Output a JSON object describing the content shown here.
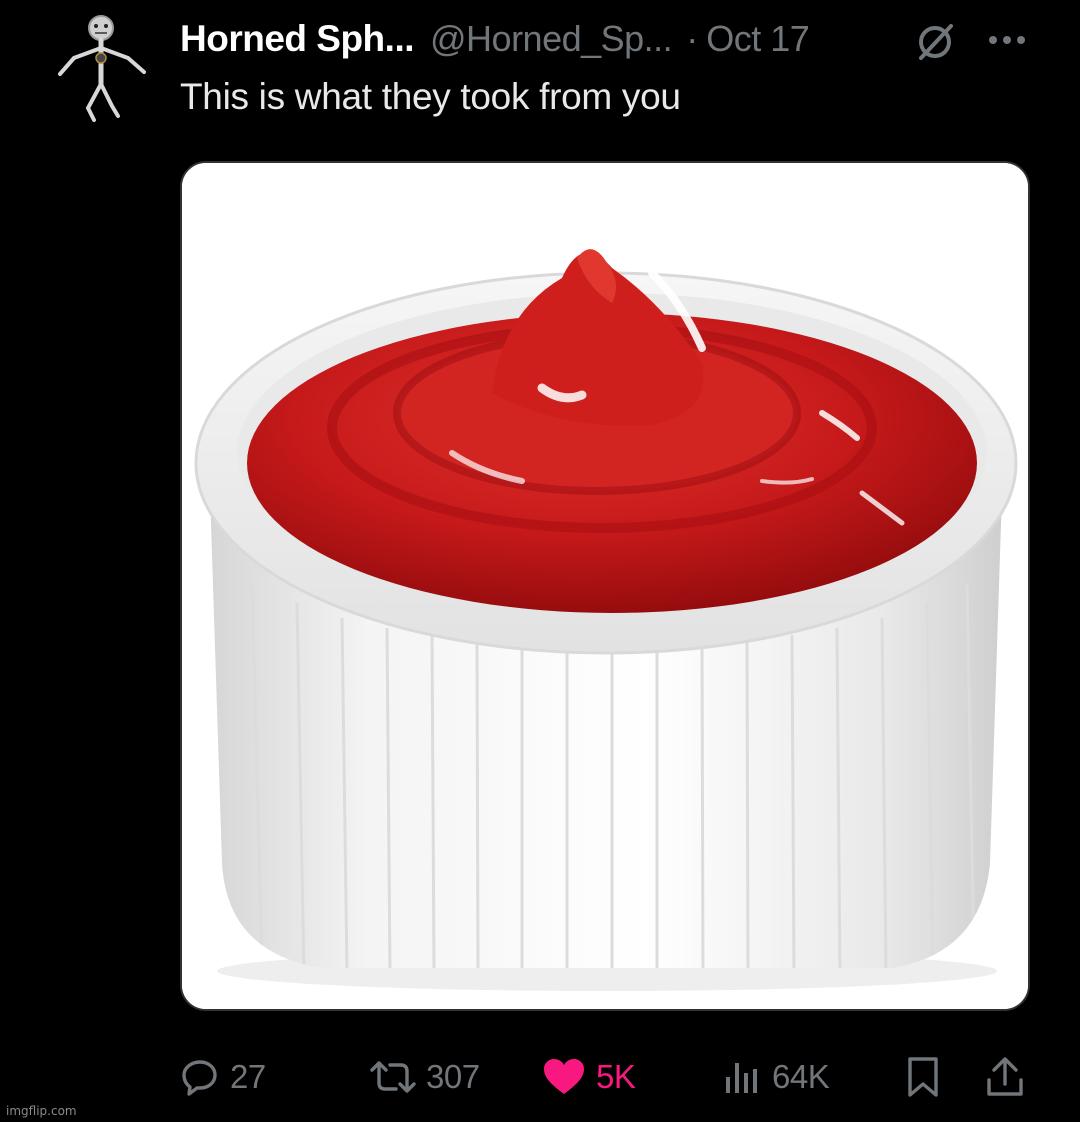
{
  "post": {
    "display_name": "Horned Sph...",
    "handle": "@Horned_Sp...",
    "separator": "·",
    "date": "Oct 17",
    "text": "This is what they took from you",
    "media_alt": "White ramekin filled with ketchup"
  },
  "icons": {
    "avatar": "stick-figure-avatar",
    "grok": "grok-icon",
    "more": "more-options-icon",
    "reply": "reply-icon",
    "repost": "repost-icon",
    "like": "heart-icon",
    "views": "views-chart-icon",
    "bookmark": "bookmark-icon",
    "share": "share-icon"
  },
  "actions": {
    "replies": "27",
    "reposts": "307",
    "likes": "5K",
    "views": "64K"
  },
  "colors": {
    "background": "#000000",
    "primary_text": "#e7e9ea",
    "secondary_text": "#71767b",
    "like_active": "#f91880",
    "border": "#2f3336"
  },
  "watermark": "imgflip.com"
}
